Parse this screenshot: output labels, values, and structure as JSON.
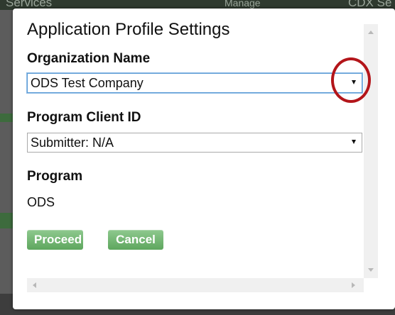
{
  "background": {
    "top_left_text": "Services",
    "top_mid_text": "Manage",
    "top_right_text": "CDX Se"
  },
  "modal": {
    "title": "Application Profile Settings",
    "organization": {
      "label": "Organization Name",
      "selected": "ODS Test Company"
    },
    "program_client": {
      "label": "Program Client ID",
      "selected": "Submitter: N/A"
    },
    "program": {
      "label": "Program",
      "value": "ODS"
    },
    "buttons": {
      "proceed": "Proceed",
      "cancel": "Cancel"
    }
  },
  "colors": {
    "button_green": "#6cb26c",
    "annotation_red": "#b3151a",
    "focus_blue": "#5b9bd5"
  }
}
